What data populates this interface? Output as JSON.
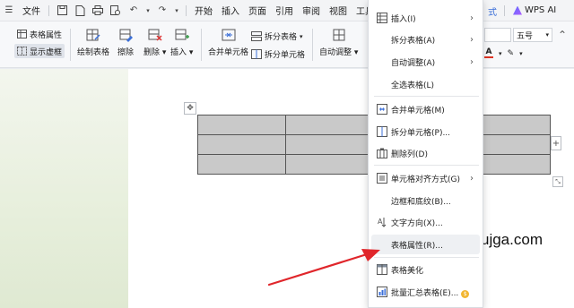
{
  "menubar": {
    "file": "文件",
    "tabs": [
      "开始",
      "插入",
      "页面",
      "引用",
      "审阅",
      "视图",
      "工具"
    ],
    "design_fragment": "式",
    "ai": "WPS AI"
  },
  "ribbon": {
    "table_props": "表格属性",
    "show_gridlines": "显示虚框",
    "draw_table": "绘制表格",
    "erase": "擦除",
    "delete": "删除",
    "insert": "插入",
    "merge_cells": "合并单元格",
    "split_table": "拆分表格",
    "split_cells": "拆分单元格",
    "auto_adjust": "自动调整",
    "font_size": "五号",
    "font_color_letter": "A"
  },
  "context_menu": {
    "items": [
      {
        "label": "插入(I)",
        "arrow": "›"
      },
      {
        "label": "拆分表格(A)",
        "arrow": "›"
      },
      {
        "label": "自动调整(A)",
        "arrow": "›"
      },
      {
        "label": "全选表格(L)"
      },
      {
        "label": "合并单元格(M)"
      },
      {
        "label": "拆分单元格(P)..."
      },
      {
        "label": "删除列(D)"
      },
      {
        "label": "单元格对齐方式(G)",
        "arrow": "›"
      },
      {
        "label": "边框和底纹(B)..."
      },
      {
        "label": "文字方向(X)..."
      },
      {
        "label": "表格属性(R)..."
      },
      {
        "label": "表格美化"
      },
      {
        "label": "批量汇总表格(E)..."
      }
    ]
  },
  "document": {
    "watermark": "ujga.com"
  },
  "colors": {
    "accent": "#3b6fd8",
    "arrow": "#e0262b",
    "table_fill": "#c9c9c9"
  }
}
